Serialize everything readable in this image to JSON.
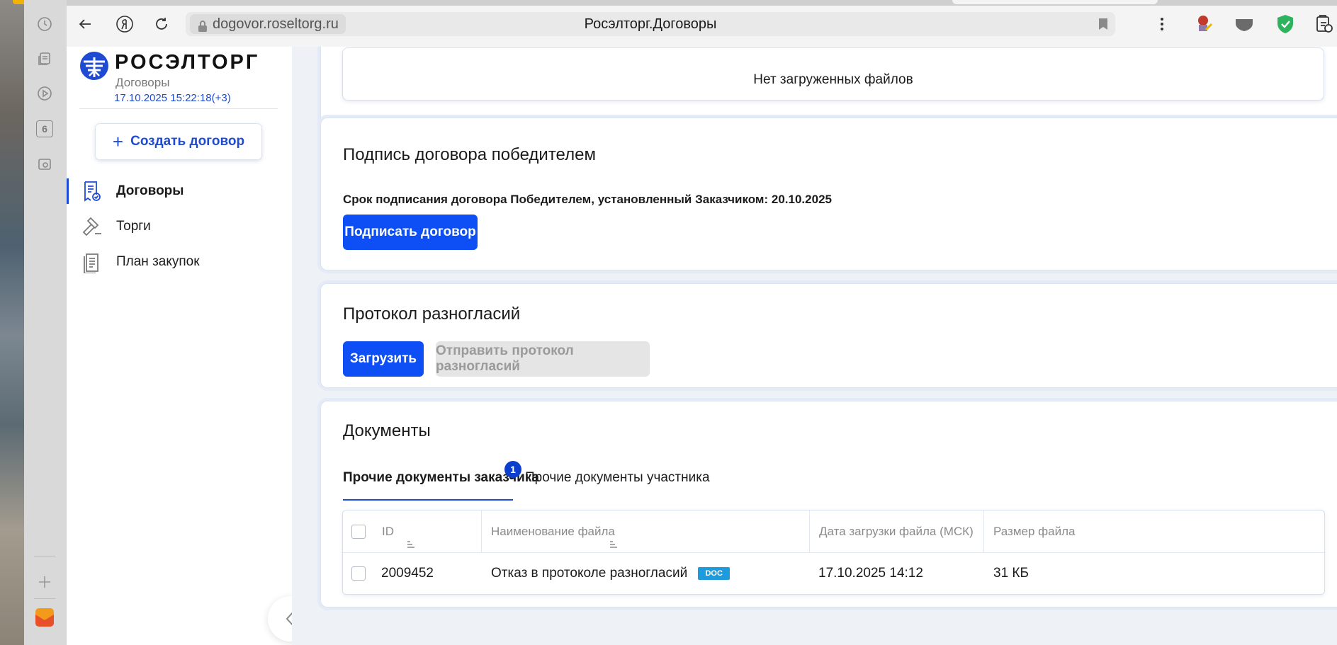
{
  "browser": {
    "url": "dogovor.roseltorg.ru",
    "page_title": "Росэлторг.Договоры",
    "side_panel": {
      "badge_number": "6"
    }
  },
  "app": {
    "brand": "РОСЭЛТОРГ",
    "subbrand": "Договоры",
    "clock": "17.10.2025 15:22:18(+3)",
    "create_button": "Создать договор",
    "nav": [
      {
        "label": "Договоры",
        "active": true
      },
      {
        "label": "Торги",
        "active": false
      },
      {
        "label": "План закупок",
        "active": false
      }
    ]
  },
  "files": {
    "empty_text": "Нет загруженных файлов"
  },
  "sign_section": {
    "title": "Подпись договора победителем",
    "deadline": "Срок подписания договора Победителем, установленный Заказчиком: 20.10.2025",
    "sign_button": "Подписать договор"
  },
  "protocol_section": {
    "title": "Протокол разногласий",
    "upload_button": "Загрузить",
    "send_button": "Отправить протокол разногласий"
  },
  "documents": {
    "title": "Документы",
    "tabs": [
      {
        "label": "Прочие документы заказчика",
        "badge": "1"
      },
      {
        "label": "Прочие документы участника"
      }
    ],
    "columns": [
      "ID",
      "Наименование файла",
      "Дата загрузки файла (МСК)",
      "Размер файла"
    ],
    "rows": [
      {
        "id": "2009452",
        "name": "Отказ в протоколе разногласий",
        "type": "DOC",
        "date": "17.10.2025 14:12",
        "size": "31 КБ"
      }
    ]
  },
  "colors": {
    "primary": "#0d4ff5",
    "link": "#1e4bd2",
    "badge": "#0d3fcf",
    "doc_badge": "#1d9bdc"
  }
}
